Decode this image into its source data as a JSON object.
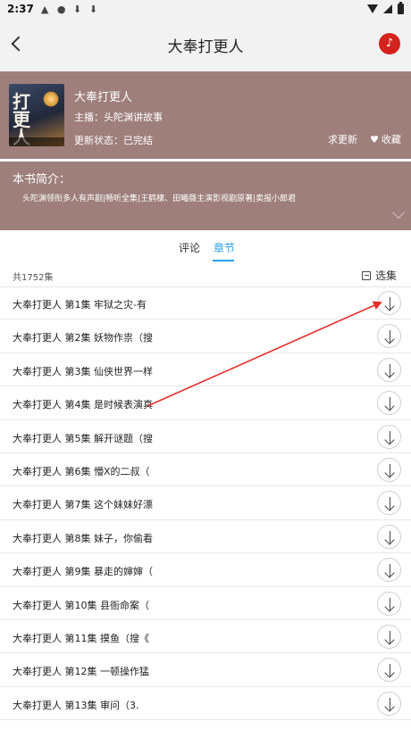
{
  "status_bar": {
    "time": "2:37"
  },
  "nav": {
    "title": "大奉打更人"
  },
  "book": {
    "title": "大奉打更人",
    "host": "主播：头陀渊讲故事",
    "status": "更新状态：已完结",
    "request_update": "求更新",
    "favorite": "收藏"
  },
  "intro": {
    "label": "本书简介：",
    "text": "头陀渊领衔多人有声剧|畅听全集|王鹤棣、田曦薇主演影视剧原著|卖报小郎君"
  },
  "tabs": {
    "comments": "评论",
    "chapters": "章节"
  },
  "list_header": {
    "count": "共1752集",
    "select": "选集"
  },
  "chapters": [
    "大奉打更人 第1集 牢狱之灾-有",
    "大奉打更人 第2集 妖物作祟（搜",
    "大奉打更人 第3集 仙侠世界一样",
    "大奉打更人 第4集 是时候表演真",
    "大奉打更人 第5集 解开谜题（搜",
    "大奉打更人 第6集 懵X的二叔（",
    "大奉打更人 第7集 这个妹妹好漂",
    "大奉打更人 第8集 妹子，你偷看",
    "大奉打更人 第9集 暴走的婶婶（",
    "大奉打更人 第10集 县衙命案（",
    "大奉打更人 第11集 摸鱼（搜《",
    "大奉打更人 第12集 一顿操作猛",
    "大奉打更人 第13集 审问（3."
  ],
  "colors": {
    "header_bg": "#9e7f7c",
    "accent": "#2aa0e6",
    "music_red": "#d3231c",
    "arrow_red": "#e5302a"
  }
}
